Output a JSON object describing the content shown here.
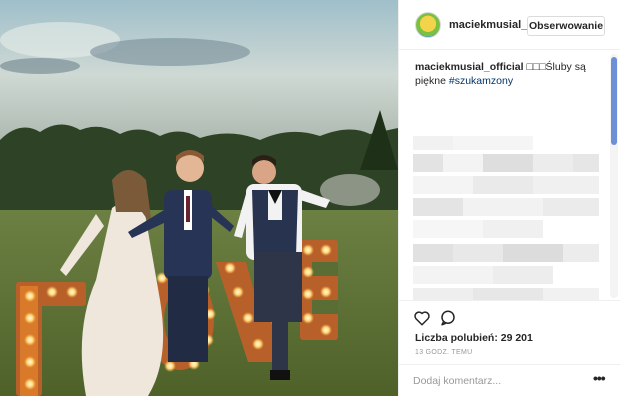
{
  "post": {
    "username": "maciekmusial_",
    "follow_label": "Obserwowanie",
    "caption_author": "maciekmusial_official",
    "caption_symbols": "□□□",
    "caption_text": "Śluby są piękne",
    "caption_hashtag": "#szukamzony",
    "likes_label": "Liczba polubień: 29 201",
    "timestamp": "13 GODZ. TEMU",
    "comment_placeholder": "Dodaj komentarz...",
    "more_symbol": "•••"
  },
  "photo": {
    "sign_text": "LOVE",
    "description_icons": [
      "heart-icon",
      "comment-icon",
      "more-options-icon"
    ]
  },
  "colors": {
    "hashtag": "#003569",
    "timestamp": "#999999",
    "scroll_thumb": "#6d8fd6",
    "marquee_letters": "#d97a2b"
  }
}
